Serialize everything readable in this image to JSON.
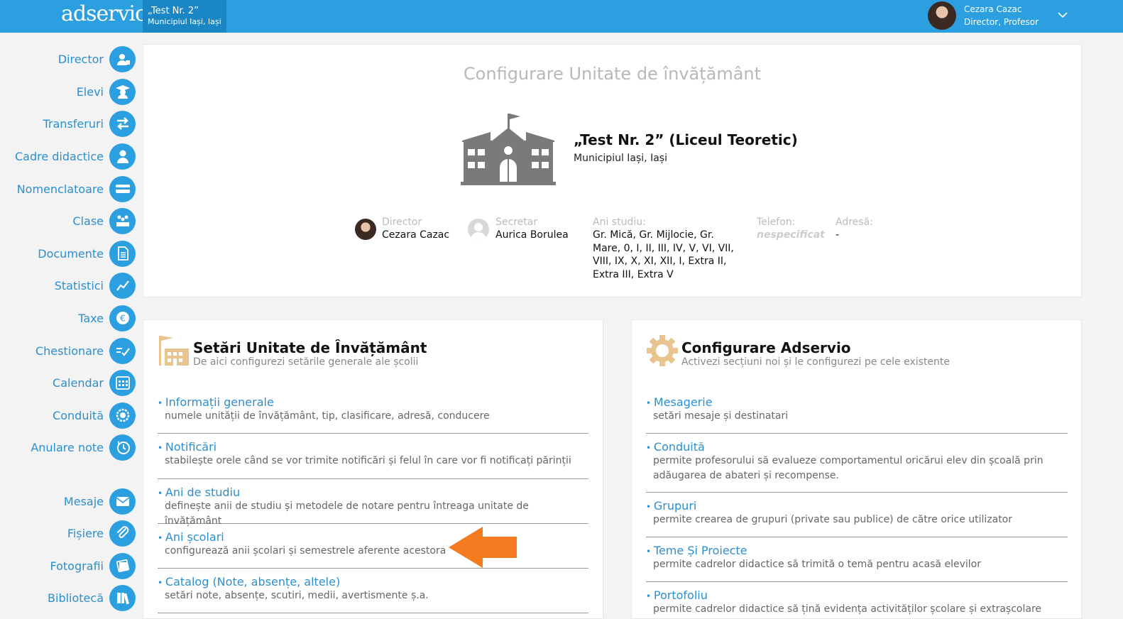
{
  "header": {
    "logo": "adservio",
    "unit_name": "„Test Nr. 2”",
    "unit_location": "Municipiul Iași, Iași",
    "user_name": "Cezara Cazac",
    "user_role": "Director, Profesor"
  },
  "sidebar": {
    "items": [
      {
        "label": "Director",
        "icon": "director-icon"
      },
      {
        "label": "Elevi",
        "icon": "graduate-icon"
      },
      {
        "label": "Transferuri",
        "icon": "transfer-arrows-icon"
      },
      {
        "label": "Cadre didactice",
        "icon": "teacher-icon"
      },
      {
        "label": "Nomenclatoare",
        "icon": "card-icon"
      },
      {
        "label": "Clase",
        "icon": "classroom-icon"
      },
      {
        "label": "Documente",
        "icon": "document-icon"
      },
      {
        "label": "Statistici",
        "icon": "chart-line-icon"
      },
      {
        "label": "Taxe",
        "icon": "euro-icon"
      },
      {
        "label": "Chestionare",
        "icon": "checklist-icon"
      },
      {
        "label": "Calendar",
        "icon": "calendar-icon"
      },
      {
        "label": "Conduită",
        "icon": "badge-icon"
      },
      {
        "label": "Anulare note",
        "icon": "clock-alert-icon"
      },
      {
        "label": "Mesaje",
        "icon": "envelope-icon"
      },
      {
        "label": "Fișiere",
        "icon": "paperclip-icon"
      },
      {
        "label": "Fotografii",
        "icon": "photos-icon"
      },
      {
        "label": "Bibliotecă",
        "icon": "books-icon"
      }
    ]
  },
  "school": {
    "page_title": "Configurare Unitate de învățământ",
    "name": "„Test Nr. 2” (Liceul Teoretic)",
    "location": "Municipiul Iași, Iași",
    "director_label": "Director",
    "director_name": "Cezara Cazac",
    "secretar_label": "Secretar",
    "secretar_name": "Aurica Borulea",
    "ani_label": "Ani studiu:",
    "ani_value": "Gr. Mică, Gr. Mijlocie, Gr. Mare, 0, I, II, III, IV, V, VI, VII, VIII, IX, X, XI, XII, I, Extra II, Extra III, Extra V",
    "telefon_label": "Telefon:",
    "telefon_value": "nespecificat",
    "adresa_label": "Adresă:",
    "adresa_value": "-"
  },
  "settings": {
    "title": "Setări Unitate de Învățământ",
    "subtitle": "De aici configurezi setările generale ale școlii",
    "items": [
      {
        "title": "Informații generale",
        "desc": "numele unității de învățământ, tip, clasificare, adresă, conducere"
      },
      {
        "title": "Notificări",
        "desc": "stabilește orele când se vor trimite notificări și felul în care vor fi notificați părinții"
      },
      {
        "title": "Ani de studiu",
        "desc": "definește anii de studiu și metodele de notare pentru întreaga unitate de învățământ"
      },
      {
        "title": "Ani școlari",
        "desc": "configurează anii școlari și semestrele aferente acestora"
      },
      {
        "title": "Catalog (Note, absențe, altele)",
        "desc": "setări note, absențe, scutiri, medii, avertismente ș.a."
      }
    ]
  },
  "adservio": {
    "title": "Configurare Adservio",
    "subtitle": "Activezi secțiuni noi și le configurezi pe cele existente",
    "items": [
      {
        "title": "Mesagerie",
        "desc": "setări mesaje și destinatari"
      },
      {
        "title": "Conduită",
        "desc": "permite profesorului să evalueze comportamentul oricărui elev din școală prin adăugarea de abateri și recompense."
      },
      {
        "title": "Grupuri",
        "desc": "permite crearea de grupuri (private sau publice) de către orice utilizator"
      },
      {
        "title": "Teme Și Proiecte",
        "desc": "permite cadrelor didactice să trimită o temă pentru acasă elevilor"
      },
      {
        "title": "Portofoliu",
        "desc": "permite cadrelor didactice să țină evidența activităților școlare și extrașcolare"
      }
    ]
  },
  "colors": {
    "brand_blue": "#2b9fe0",
    "dark_blue": "#1b86c4",
    "link_blue": "#2b8fd0",
    "arrow_orange": "#f47b20",
    "icon_gray": "#7a7a7a",
    "icon_tan": "#e8c48f"
  }
}
